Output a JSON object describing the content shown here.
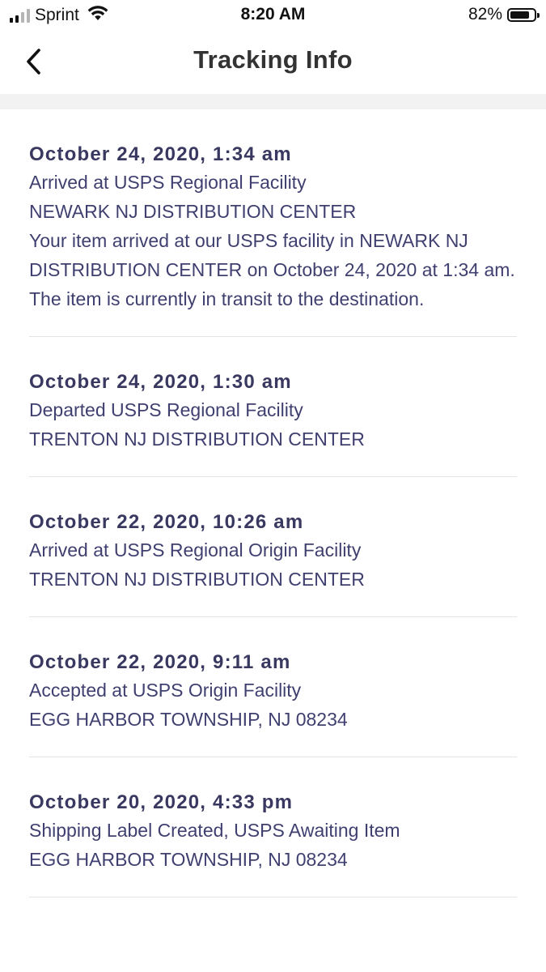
{
  "status_bar": {
    "carrier": "Sprint",
    "time": "8:20 AM",
    "battery_percent": "82%",
    "battery_level": 0.82,
    "signal_icon": "cellular-signal-icon",
    "wifi_icon": "wifi-icon",
    "battery_icon": "battery-icon"
  },
  "nav": {
    "title": "Tracking Info",
    "back_icon": "chevron-left-icon"
  },
  "colors": {
    "text_primary": "#3f3f70",
    "date_text": "#383860",
    "divider": "#e4e4e4",
    "section_gap": "#f2f2f2"
  },
  "events": [
    {
      "date": "October 24, 2020, 1:34 am",
      "status": "Arrived at USPS Regional Facility",
      "location": "NEWARK NJ DISTRIBUTION CENTER",
      "description": "Your item arrived at our USPS facility in NEWARK NJ DISTRIBUTION CENTER on October 24, 2020 at 1:34 am. The item is currently in transit to the destination."
    },
    {
      "date": "October 24, 2020, 1:30 am",
      "status": "Departed USPS Regional Facility",
      "location": "TRENTON NJ DISTRIBUTION CENTER",
      "description": ""
    },
    {
      "date": "October 22, 2020, 10:26 am",
      "status": "Arrived at USPS Regional Origin Facility",
      "location": "TRENTON NJ DISTRIBUTION CENTER",
      "description": ""
    },
    {
      "date": "October 22, 2020, 9:11 am",
      "status": "Accepted at USPS Origin Facility",
      "location": "EGG HARBOR TOWNSHIP, NJ 08234",
      "description": ""
    },
    {
      "date": "October 20, 2020, 4:33 pm",
      "status": "Shipping Label Created, USPS Awaiting Item",
      "location": "EGG HARBOR TOWNSHIP, NJ 08234",
      "description": ""
    }
  ]
}
